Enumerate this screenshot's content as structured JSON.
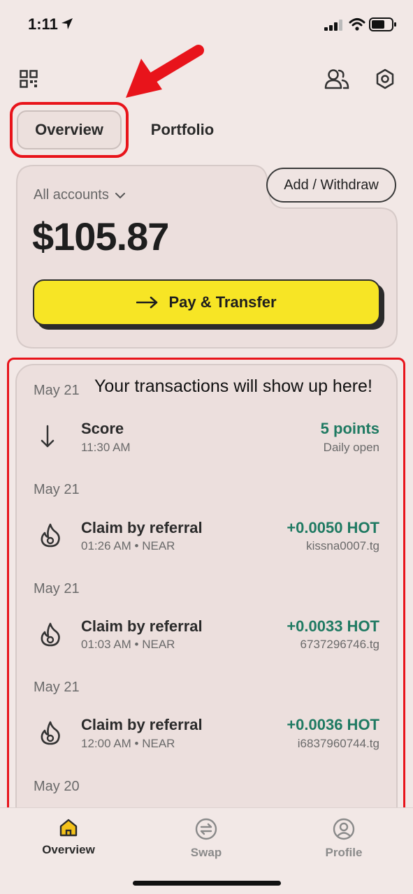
{
  "status_bar": {
    "time": "1:11"
  },
  "tabs": [
    {
      "label": "Overview",
      "active": true
    },
    {
      "label": "Portfolio",
      "active": false
    }
  ],
  "balance_card": {
    "account_selector": "All accounts",
    "balance": "$105.87",
    "add_withdraw_label": "Add / Withdraw",
    "pay_transfer_label": "Pay & Transfer"
  },
  "transactions": {
    "hint": "Your transactions will show up here!",
    "items": [
      {
        "date": "May 21",
        "title": "Score",
        "subtitle": "11:30 AM",
        "amount": "5 points",
        "meta": "Daily open",
        "icon": "arrow-down-icon"
      },
      {
        "date": "May 21",
        "title": "Claim by referral",
        "subtitle": "01:26 AM • NEAR",
        "amount": "+0.0050 HOT",
        "meta": "kissna0007.tg",
        "icon": "flame-icon"
      },
      {
        "date": "May 21",
        "title": "Claim by referral",
        "subtitle": "01:03 AM • NEAR",
        "amount": "+0.0033 HOT",
        "meta": "6737296746.tg",
        "icon": "flame-icon"
      },
      {
        "date": "May 21",
        "title": "Claim by referral",
        "subtitle": "12:00 AM • NEAR",
        "amount": "+0.0036 HOT",
        "meta": "i6837960744.tg",
        "icon": "flame-icon"
      }
    ],
    "trailing_date": "May 20"
  },
  "bottom_nav": [
    {
      "label": "Overview",
      "icon": "home-icon",
      "active": true
    },
    {
      "label": "Swap",
      "icon": "swap-icon",
      "active": false
    },
    {
      "label": "Profile",
      "icon": "profile-icon",
      "active": false
    }
  ],
  "colors": {
    "background": "#f2e8e6",
    "accent_yellow": "#f7e525",
    "positive_green": "#1f7a62",
    "annotation_red": "#e8141b"
  }
}
